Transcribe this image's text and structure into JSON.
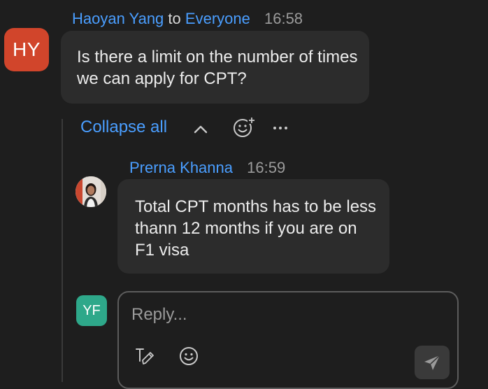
{
  "message": {
    "avatar_initials": "HY",
    "sender": "Haoyan Yang",
    "to_word": "to",
    "recipient": "Everyone",
    "time": "16:58",
    "text": "Is there a limit on the number of times we can apply for CPT?"
  },
  "thread": {
    "collapse_label": "Collapse all"
  },
  "reply": {
    "sender": "Prerna Khanna",
    "time": "16:59",
    "text": "Total CPT months has to be less thann 12 months if you are on F1 visa"
  },
  "composer": {
    "avatar_initials": "YF",
    "placeholder": "Reply..."
  },
  "colors": {
    "link": "#4a9eff",
    "avatar_hy": "#d1452b",
    "avatar_yf": "#2ea88a",
    "bubble": "#2c2c2c",
    "background": "#1e1e1e"
  },
  "icons": [
    "chevron-up-icon",
    "emoji-add-icon",
    "more-icon",
    "format-text-icon",
    "emoji-icon",
    "send-icon"
  ]
}
